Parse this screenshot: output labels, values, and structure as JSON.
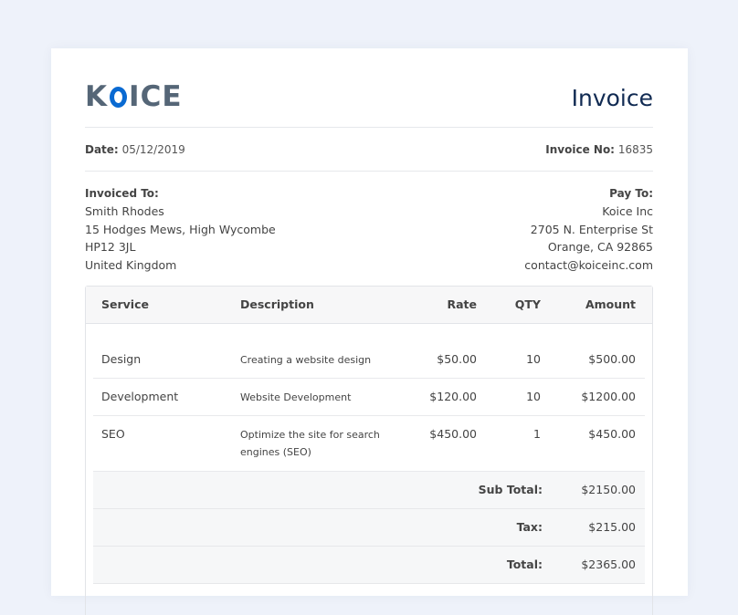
{
  "header": {
    "logo_pre": "K",
    "logo_post": "ICE",
    "title": "Invoice",
    "colors": {
      "brand": "#0a6ad2",
      "logo_text": "#556677",
      "title": "#102a52"
    }
  },
  "meta": {
    "date_label": "Date:",
    "date_value": "05/12/2019",
    "invoice_no_label": "Invoice No:",
    "invoice_no_value": "16835"
  },
  "invoiced_to": {
    "heading": "Invoiced To:",
    "lines": [
      "Smith Rhodes",
      "15 Hodges Mews, High Wycombe",
      "HP12 3JL",
      "United Kingdom"
    ]
  },
  "pay_to": {
    "heading": "Pay To:",
    "lines": [
      "Koice Inc",
      "2705 N. Enterprise St",
      "Orange, CA 92865",
      "contact@koiceinc.com"
    ]
  },
  "table": {
    "columns": {
      "service": "Service",
      "description": "Description",
      "rate": "Rate",
      "qty": "QTY",
      "amount": "Amount"
    },
    "rows": [
      {
        "service": "Design",
        "description": "Creating a website design",
        "rate": "$50.00",
        "qty": "10",
        "amount": "$500.00"
      },
      {
        "service": "Development",
        "description": "Website Development",
        "rate": "$120.00",
        "qty": "10",
        "amount": "$1200.00"
      },
      {
        "service": "SEO",
        "description": "Optimize the site for search engines (SEO)",
        "rate": "$450.00",
        "qty": "1",
        "amount": "$450.00"
      }
    ]
  },
  "totals": {
    "subtotal_label": "Sub Total:",
    "subtotal_value": "$2150.00",
    "tax_label": "Tax:",
    "tax_value": "$215.00",
    "total_label": "Total:",
    "total_value": "$2365.00"
  }
}
